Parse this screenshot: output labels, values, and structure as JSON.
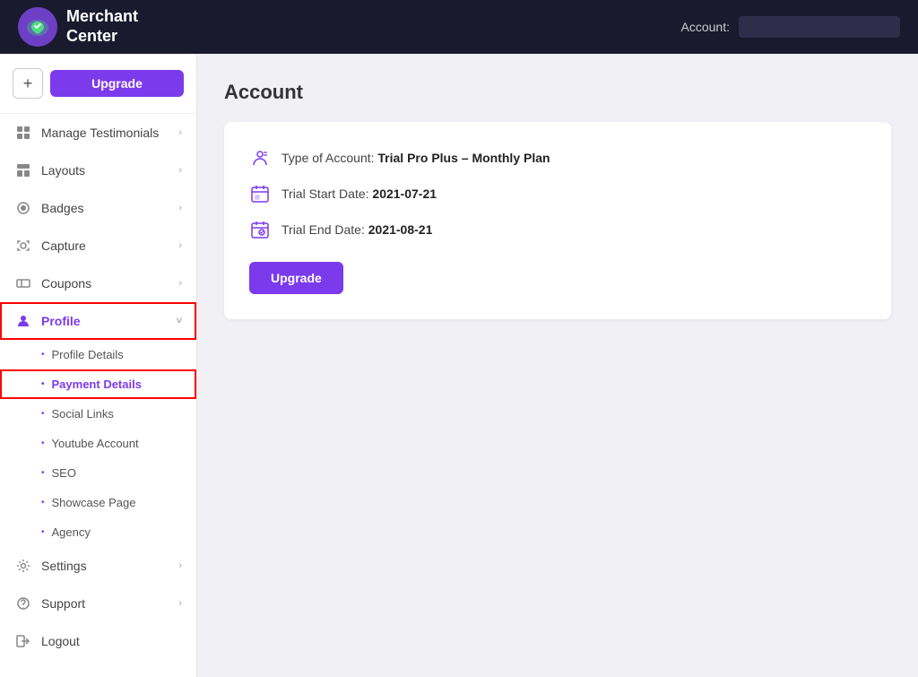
{
  "header": {
    "logo_line1": "Merchant",
    "logo_line2": "Center",
    "account_label": "Account:",
    "account_value": ""
  },
  "sidebar": {
    "plus_label": "+",
    "upgrade_label": "Upgrade",
    "nav_items": [
      {
        "id": "manage-testimonials",
        "label": "Manage Testimonials",
        "icon": "grid",
        "has_chevron": true,
        "active": false
      },
      {
        "id": "layouts",
        "label": "Layouts",
        "icon": "layout",
        "has_chevron": true,
        "active": false
      },
      {
        "id": "badges",
        "label": "Badges",
        "icon": "badge",
        "has_chevron": true,
        "active": false
      },
      {
        "id": "capture",
        "label": "Capture",
        "icon": "capture",
        "has_chevron": true,
        "active": false
      },
      {
        "id": "coupons",
        "label": "Coupons",
        "icon": "coupon",
        "has_chevron": true,
        "active": false
      },
      {
        "id": "profile",
        "label": "Profile",
        "icon": "user",
        "has_chevron": true,
        "active": true
      }
    ],
    "sub_items": [
      {
        "id": "profile-details",
        "label": "Profile Details",
        "active": false
      },
      {
        "id": "payment-details",
        "label": "Payment Details",
        "active": true
      },
      {
        "id": "social-links",
        "label": "Social Links",
        "active": false
      },
      {
        "id": "youtube-account",
        "label": "Youtube Account",
        "active": false
      },
      {
        "id": "seo",
        "label": "SEO",
        "active": false
      },
      {
        "id": "showcase-page",
        "label": "Showcase Page",
        "active": false
      },
      {
        "id": "agency",
        "label": "Agency",
        "active": false
      }
    ],
    "bottom_items": [
      {
        "id": "settings",
        "label": "Settings",
        "icon": "gear",
        "has_chevron": true
      },
      {
        "id": "support",
        "label": "Support",
        "icon": "support",
        "has_chevron": true
      },
      {
        "id": "logout",
        "label": "Logout",
        "icon": "logout",
        "has_chevron": false
      }
    ]
  },
  "main": {
    "page_title": "Account",
    "card": {
      "type_label": "Type of Account:",
      "type_value": "Trial Pro Plus – Monthly Plan",
      "start_label": "Trial Start Date:",
      "start_value": "2021-07-21",
      "end_label": "Trial End Date:",
      "end_value": "2021-08-21",
      "upgrade_button": "Upgrade"
    }
  }
}
